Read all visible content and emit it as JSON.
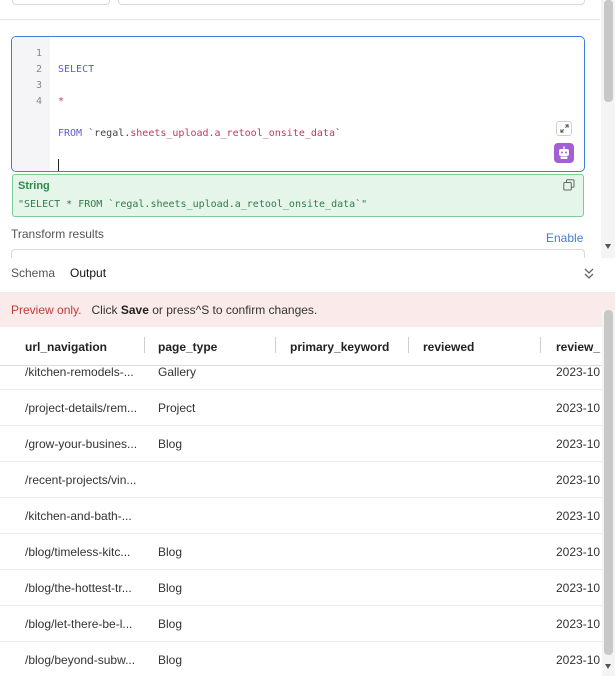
{
  "editor": {
    "line_numbers": [
      "1",
      "2",
      "3",
      "4"
    ],
    "lines": {
      "l1_kw": "SELECT",
      "l2_star": "*",
      "l3_kw": "FROM",
      "l3_tick_open": " `",
      "l3_schema": "regal.",
      "l3_table": "sheets_upload.a_retool_onsite_data",
      "l3_tick_close": "`"
    }
  },
  "string_preview": {
    "type": "String",
    "value": "\"SELECT * FROM `regal.sheets_upload.a_retool_onsite_data`\""
  },
  "transform": {
    "label": "Transform results",
    "enable_label": "Enable"
  },
  "panel": {
    "tabs": {
      "schema": "Schema",
      "output": "Output"
    }
  },
  "banner": {
    "strong": "Preview only.",
    "pre": "Click",
    "save": "Save",
    "post": "or press^S to confirm changes."
  },
  "table": {
    "headers": [
      "url_navigation",
      "page_type",
      "primary_keyword",
      "reviewed",
      "review_"
    ],
    "rows": [
      {
        "url": "/kitchen-remodels-...",
        "type": "Gallery",
        "date": "2023-10"
      },
      {
        "url": "/project-details/rem...",
        "type": "Project",
        "date": "2023-10"
      },
      {
        "url": "/grow-your-busines...",
        "type": "Blog",
        "date": "2023-10"
      },
      {
        "url": "/recent-projects/vin...",
        "type": "",
        "date": "2023-10"
      },
      {
        "url": "/kitchen-and-bath-...",
        "type": "",
        "date": "2023-10"
      },
      {
        "url": "/blog/timeless-kitc...",
        "type": "Blog",
        "date": "2023-10"
      },
      {
        "url": "/blog/the-hottest-tr...",
        "type": "Blog",
        "date": "2023-10"
      },
      {
        "url": "/blog/let-there-be-l...",
        "type": "Blog",
        "date": "2023-10"
      },
      {
        "url": "/blog/beyond-subw...",
        "type": "Blog",
        "date": "2023-10"
      }
    ]
  },
  "colors": {
    "accent": "#3d7fd9",
    "ai_button": "#a260d4",
    "success_bg": "#e6f5ea",
    "warning_bg": "#fbeaea"
  },
  "icons": {
    "expand": "expand-icon",
    "ai": "ai-assistant-icon",
    "copy": "copy-icon",
    "collapse": "chevron-double-down-icon"
  }
}
